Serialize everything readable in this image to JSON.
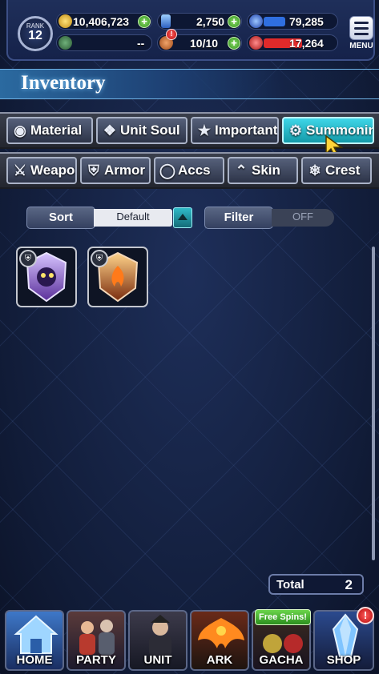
{
  "header": {
    "rank_label": "RANK",
    "rank_value": "12",
    "gil": "10,406,723",
    "crystals": "2,750",
    "ap": "79,285",
    "ap_fill_percent": 45,
    "unknown_stat": "--",
    "stamina": "10/10",
    "hp": "17,264",
    "hp_fill_percent": 80,
    "menu_label": "MENU",
    "alert_symbol": "!"
  },
  "page": {
    "title": "Inventory"
  },
  "tabs_row1": [
    {
      "label": "Material",
      "icon": "bag-icon"
    },
    {
      "label": "Unit Soul",
      "icon": "soul-icon"
    },
    {
      "label": "Important",
      "icon": "star-icon"
    },
    {
      "label": "Summoning",
      "icon": "summon-icon",
      "active": true
    }
  ],
  "tabs_row2": [
    {
      "label": "Weapon",
      "icon": "sword-icon"
    },
    {
      "label": "Armor",
      "icon": "armor-icon"
    },
    {
      "label": "Accs",
      "icon": "ring-icon"
    },
    {
      "label": "Skin",
      "icon": "hanger-icon"
    },
    {
      "label": "Crest",
      "icon": "crest-icon"
    }
  ],
  "controls": {
    "sort_label": "Sort",
    "sort_value": "Default",
    "filter_label": "Filter",
    "filter_value": "OFF"
  },
  "items": [
    {
      "name": "purple-summon-stone",
      "color": "#9b6bd6"
    },
    {
      "name": "fire-summon-stone",
      "color": "#d86a2a"
    }
  ],
  "total": {
    "label": "Total",
    "value": "2"
  },
  "nav": {
    "home": "HOME",
    "party": "PARTY",
    "unit": "UNIT",
    "ark": "ARK",
    "gacha": "GACHA",
    "shop": "SHOP",
    "free_spins": "Free Spins!",
    "shop_alert": "!"
  },
  "colors": {
    "active_tab": "#2cc3d4",
    "ap_bar": "#2f6fe0",
    "hp_bar": "#e02a2a",
    "plus_button": "#4cbf2e"
  }
}
